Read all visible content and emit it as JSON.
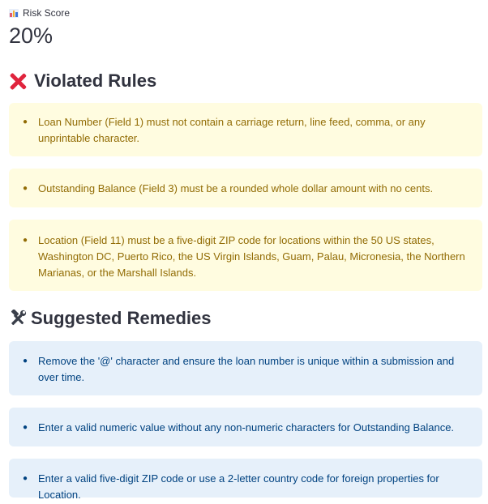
{
  "metric": {
    "label": "Risk Score",
    "value": "20%"
  },
  "violated": {
    "heading": "Violated Rules",
    "items": [
      "Loan Number (Field 1) must not contain a carriage return, line feed, comma, or any unprintable character.",
      "Outstanding Balance (Field 3) must be a rounded whole dollar amount with no cents.",
      "Location (Field 11) must be a five-digit ZIP code for locations within the 50 US states, Washington DC, Puerto Rico, the US Virgin Islands, Guam, Palau, Micronesia, the Northern Marianas, or the Marshall Islands."
    ]
  },
  "remedies": {
    "heading": "Suggested Remedies",
    "items": [
      "Remove the '@' character and ensure the loan number is unique within a submission and over time.",
      "Enter a valid numeric value without any non-numeric characters for Outstanding Balance.",
      "Enter a valid five-digit ZIP code or use a 2-letter country code for foreign properties for Location."
    ]
  },
  "colors": {
    "warning_bg": "#fffce0",
    "warning_text": "#926c05",
    "info_bg": "#e6f0fa",
    "info_text": "#004280",
    "x_icon": "#e0243d"
  },
  "icons": {
    "metric": "bar-chart-icon",
    "violated": "cross-mark-icon",
    "remedies": "hammer-wrench-icon"
  }
}
